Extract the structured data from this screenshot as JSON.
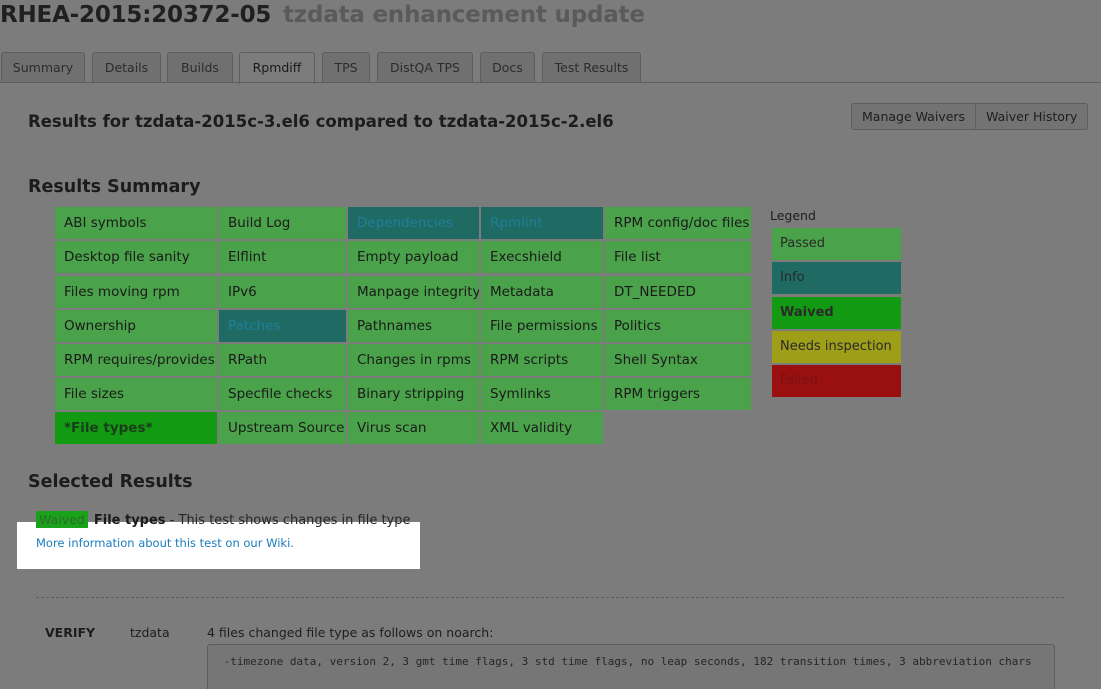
{
  "header": {
    "advisory": "RHEA-2015:20372-05",
    "synopsis": "tzdata enhancement update"
  },
  "tabs": [
    {
      "label": "Summary",
      "active": false
    },
    {
      "label": "Details",
      "active": false
    },
    {
      "label": "Builds",
      "active": false
    },
    {
      "label": "Rpmdiff",
      "active": true
    },
    {
      "label": "TPS",
      "active": false
    },
    {
      "label": "DistQA TPS",
      "active": false
    },
    {
      "label": "Docs",
      "active": false
    },
    {
      "label": "Test Results",
      "active": false
    }
  ],
  "main": {
    "results_for": "Results for tzdata-2015c-3.el6 compared to tzdata-2015c-2.el6",
    "manage_waivers_label": "Manage Waivers",
    "waiver_history_label": "Waiver History",
    "summary_heading": "Results Summary",
    "selected_heading": "Selected Results"
  },
  "tests": [
    [
      "ABI symbols",
      "Build Log",
      "Dependencies",
      "Rpmlint",
      "RPM config/doc files"
    ],
    [
      "Desktop file sanity",
      "Elflint",
      "Empty payload",
      "Execshield",
      "File list"
    ],
    [
      "Files moving rpm",
      "IPv6",
      "Manpage integrity",
      "Metadata",
      "DT_NEEDED"
    ],
    [
      "Ownership",
      "Patches",
      "Pathnames",
      "File permissions",
      "Politics"
    ],
    [
      "RPM requires/provides",
      "RPath",
      "Changes in rpms",
      "RPM scripts",
      "Shell Syntax"
    ],
    [
      "File sizes",
      "Specfile checks",
      "Binary stripping",
      "Symlinks",
      "RPM triggers"
    ],
    [
      "*File types*",
      "Upstream Source",
      "Virus scan",
      "XML validity",
      ""
    ]
  ],
  "test_status": [
    [
      "passed",
      "passed",
      "info",
      "info",
      "passed"
    ],
    [
      "passed",
      "passed",
      "passed",
      "passed",
      "passed"
    ],
    [
      "passed",
      "passed",
      "passed",
      "passed",
      "passed"
    ],
    [
      "passed",
      "info",
      "passed",
      "passed",
      "passed"
    ],
    [
      "passed",
      "passed",
      "passed",
      "passed",
      "passed"
    ],
    [
      "passed",
      "passed",
      "passed",
      "passed",
      "passed"
    ],
    [
      "waived",
      "passed",
      "passed",
      "passed",
      ""
    ]
  ],
  "legend": {
    "title": "Legend",
    "items": [
      {
        "label": "Passed",
        "status": "passed"
      },
      {
        "label": "Info",
        "status": "info"
      },
      {
        "label": "Waived",
        "status": "waived"
      },
      {
        "label": "Needs inspection",
        "status": "needs"
      },
      {
        "label": "Failed",
        "status": "failed"
      }
    ]
  },
  "selected": {
    "badge": "Waived",
    "test_name": "File types",
    "description": " - This test shows changes in file type",
    "wiki_link": "More information about this test on our Wiki."
  },
  "detail": {
    "result": "VERIFY",
    "package": "tzdata",
    "message": "4 files changed file type as follows on noarch:",
    "log": " -timezone data, version 2, 3 gmt time flags, 3 std time flags, no leap seconds, 182 transition times, 3 abbreviation chars"
  },
  "colors": {
    "passed": "#4aa34a",
    "info": "#1f6a63",
    "waived": "#129b12",
    "needs": "#9e9e18",
    "failed": "#9a1010",
    "link": "#1a7ebd"
  }
}
